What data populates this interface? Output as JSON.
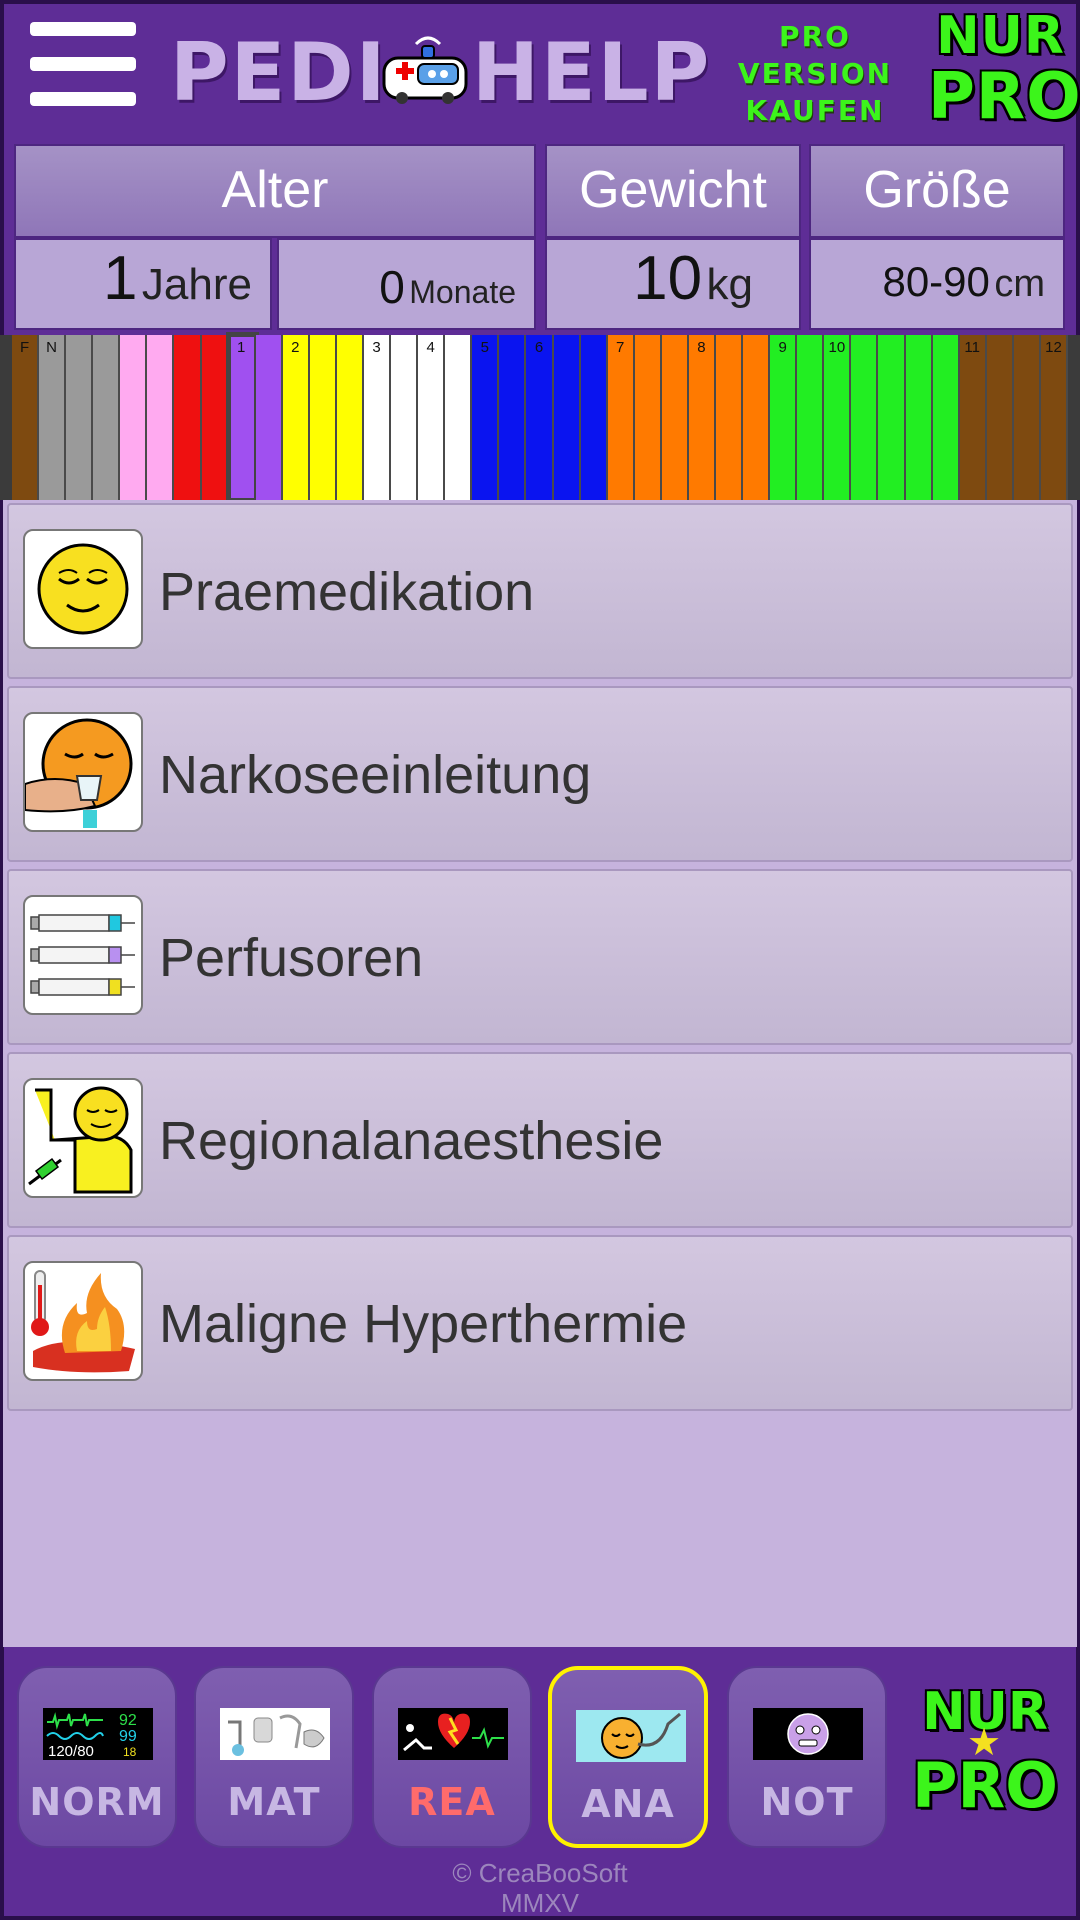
{
  "header": {
    "logo_part1": "PEDI",
    "logo_part2": "HELP",
    "pro_line1": "PRO",
    "pro_line2": "VERSION",
    "pro_line3": "KAUFEN",
    "nur_pro_line1": "NUR",
    "nur_pro_line2": "PRO"
  },
  "params": {
    "alter_label": "Alter",
    "gewicht_label": "Gewicht",
    "groesse_label": "Größe",
    "jahre_value": "1",
    "jahre_unit": "Jahre",
    "monate_value": "0",
    "monate_unit": "Monate",
    "gewicht_value": "10",
    "gewicht_unit": "kg",
    "groesse_value": "80-90",
    "groesse_unit": "cm"
  },
  "tape": {
    "selected_label": "1",
    "colors": {
      "brown": "#7e4a10",
      "grey": "#9a9a9a",
      "pink": "#ffaaf0",
      "red": "#ef1010",
      "purple": "#a050f0",
      "yellow": "#ffff00",
      "white": "#ffffff",
      "blue": "#0a14f0",
      "orange": "#ff7a00",
      "green": "#22ee22"
    },
    "stripes": [
      {
        "c": "brown",
        "l": "F"
      },
      {
        "c": "grey",
        "l": "N"
      },
      {
        "c": "grey",
        "l": ""
      },
      {
        "c": "grey",
        "l": ""
      },
      {
        "c": "pink",
        "l": ""
      },
      {
        "c": "pink",
        "l": ""
      },
      {
        "c": "red",
        "l": ""
      },
      {
        "c": "red",
        "l": ""
      },
      {
        "c": "purple",
        "l": "1"
      },
      {
        "c": "purple",
        "l": ""
      },
      {
        "c": "yellow",
        "l": "2"
      },
      {
        "c": "yellow",
        "l": ""
      },
      {
        "c": "yellow",
        "l": ""
      },
      {
        "c": "white",
        "l": "3"
      },
      {
        "c": "white",
        "l": ""
      },
      {
        "c": "white",
        "l": "4"
      },
      {
        "c": "white",
        "l": ""
      },
      {
        "c": "blue",
        "l": "5"
      },
      {
        "c": "blue",
        "l": ""
      },
      {
        "c": "blue",
        "l": "6"
      },
      {
        "c": "blue",
        "l": ""
      },
      {
        "c": "blue",
        "l": ""
      },
      {
        "c": "orange",
        "l": "7"
      },
      {
        "c": "orange",
        "l": ""
      },
      {
        "c": "orange",
        "l": ""
      },
      {
        "c": "orange",
        "l": "8"
      },
      {
        "c": "orange",
        "l": ""
      },
      {
        "c": "orange",
        "l": ""
      },
      {
        "c": "green",
        "l": "9"
      },
      {
        "c": "green",
        "l": ""
      },
      {
        "c": "green",
        "l": "10"
      },
      {
        "c": "green",
        "l": ""
      },
      {
        "c": "green",
        "l": ""
      },
      {
        "c": "green",
        "l": ""
      },
      {
        "c": "green",
        "l": ""
      },
      {
        "c": "brown",
        "l": "11"
      },
      {
        "c": "brown",
        "l": ""
      },
      {
        "c": "brown",
        "l": ""
      },
      {
        "c": "brown",
        "l": "12"
      }
    ]
  },
  "menu": {
    "items": [
      {
        "label": "Praemedikation",
        "icon": "sleepy-face-icon"
      },
      {
        "label": "Narkoseeinleitung",
        "icon": "mask-induction-icon"
      },
      {
        "label": "Perfusoren",
        "icon": "syringes-icon"
      },
      {
        "label": "Regionalanaesthesie",
        "icon": "regional-block-icon"
      },
      {
        "label": "Maligne Hyperthermie",
        "icon": "fire-thermometer-icon"
      }
    ]
  },
  "nav": {
    "norm_label": "NORM",
    "norm_bp": "120/80",
    "norm_spo2": "92",
    "norm_hr": "99",
    "norm_rr": "18",
    "mat_label": "MAT",
    "rea_label": "REA",
    "ana_label": "ANA",
    "not_label": "NOT",
    "pro_line1": "NUR",
    "pro_line2": "PRO",
    "active": "ANA"
  },
  "footer": {
    "line1": "© CreaBooSoft",
    "line2": "MMXV"
  }
}
